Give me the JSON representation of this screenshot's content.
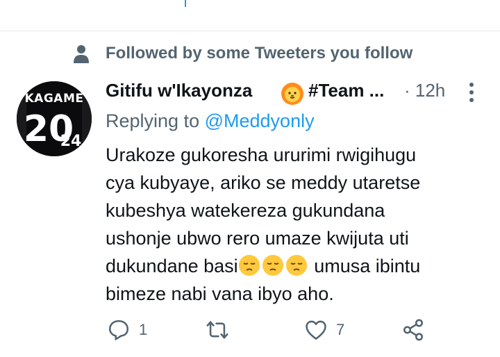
{
  "social_context": {
    "text": "Followed by some Tweeters you follow",
    "icon": "person-icon"
  },
  "tweet": {
    "display_name": "Gitifu w'Ikayonza",
    "name_suffix": "#Team ...",
    "timestamp": "· 12h",
    "avatar_text": {
      "top": "KAGAME",
      "number_big": "20",
      "number_small": "24"
    },
    "replying_to_label": "Replying to",
    "replying_to_handle": "@Meddyonly",
    "body_lines": [
      "Urakoze gukoresha ururimi rwigihugu",
      "cya kubyaye, ariko se meddy utaretse",
      "kubeshya watekereza gukundana",
      "ushonje ubwo rero umaze kwijuta uti",
      "dukundane basi",
      "umusa ibintu",
      "bimeze nabi vana ibyo aho."
    ],
    "actions": {
      "reply_count": "1",
      "retweet_count": "",
      "like_count": "7"
    }
  },
  "colors": {
    "accent": "#1d9bf0",
    "secondary": "#536471",
    "text": "#0f1419",
    "emoji": "#ffc83d"
  }
}
